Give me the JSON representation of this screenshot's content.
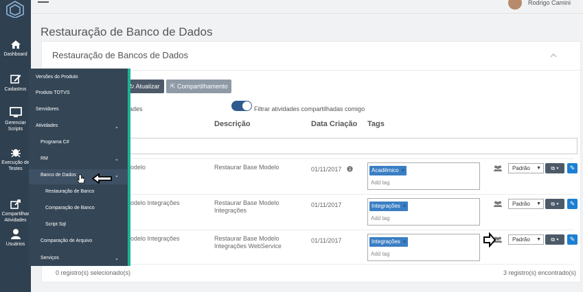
{
  "colors": {
    "sidebar": "#2f4050",
    "dropdown": "#344656",
    "accent": "#1ab394",
    "tag": "#3a7ec4",
    "edit": "#1d7fd1"
  },
  "sidebar": {
    "items": [
      {
        "label": "Dashboard",
        "icon": "home-icon"
      },
      {
        "label": "Cadastros",
        "icon": "edit-icon"
      },
      {
        "label": "Gerenciar Scripts",
        "icon": "monitor-icon"
      },
      {
        "label": "Execução de Testes",
        "icon": "bug-icon"
      },
      {
        "label": "Compartilhar Atividades",
        "icon": "share-icon"
      },
      {
        "label": "Usuários",
        "icon": "user-icon"
      }
    ]
  },
  "header": {
    "user_name": "Rodrigo Camini"
  },
  "page": {
    "title": "Restauração de Banco de Dados",
    "panel_title": "Restauração de Bancos de Dados"
  },
  "toolbar": {
    "refresh": "Atualizar",
    "share": "Compartilhamento"
  },
  "filters": {
    "ativ_label": "ades",
    "toggle_label": "Filtrar atividades compartilhadas comigo"
  },
  "table": {
    "headers": {
      "descricao": "Descrição",
      "data": "Data Criação",
      "tags": "Tags"
    },
    "rows": [
      {
        "name": "odelo",
        "desc": "Restaurar Base Modelo",
        "date": "01/11/2017",
        "tag": "Acadêmico",
        "add_tag": "Add tag",
        "select": "Padrão"
      },
      {
        "name": "odelo Integrações",
        "desc": "Restaurar Base Modelo Integrações",
        "date": "01/11/2017",
        "tag": "Integrações",
        "add_tag": "Add tag",
        "select": "Padrão"
      },
      {
        "name": "odelo Integrações",
        "desc": "Restaurar Base Modelo Integrações WebService",
        "date": "01/11/2017",
        "tag": "Integrações",
        "add_tag": "Add tag",
        "select": "Padrão"
      }
    ]
  },
  "footer": {
    "selected": "0 registro(s) selecionado(s)",
    "found": "3 registro(s) encontrado(s)"
  },
  "dropdown_menu": {
    "items": [
      "Versões do Produto",
      "Produto TOTVS",
      "Servidores",
      "Atividades",
      "Programa C#",
      "RM",
      "Banco de Dados",
      "Restauração de Banco",
      "Comparação de Banco",
      "Script Sql",
      "Comparação de Arquivo",
      "Serviços"
    ]
  }
}
